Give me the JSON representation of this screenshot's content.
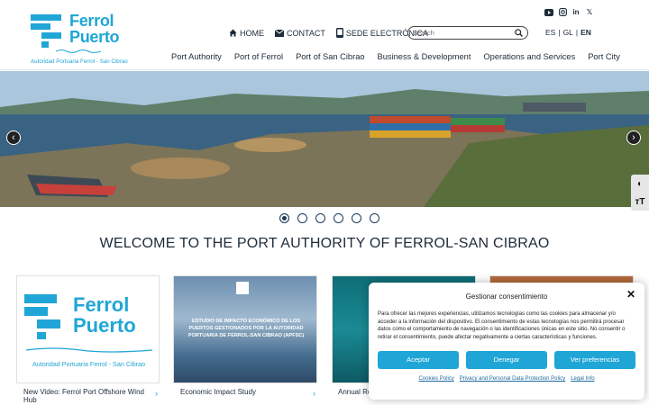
{
  "brand": {
    "name_line1": "Ferrol",
    "name_line2": "Puerto",
    "subtitle": "Autoridad Portuaria Ferrol - San Cibrao",
    "color": "#1fa6d6"
  },
  "toplinks": [
    {
      "label": "HOME",
      "icon": "home-icon"
    },
    {
      "label": "CONTACT",
      "icon": "mail-icon"
    },
    {
      "label": "SEDE ELECTRÓNICA",
      "icon": "phone-icon"
    }
  ],
  "search": {
    "placeholder": "Search"
  },
  "social": [
    "youtube-icon",
    "instagram-icon",
    "linkedin-icon",
    "x-icon"
  ],
  "lang": {
    "es": "ES",
    "gl": "GL",
    "en": "EN",
    "sep": "|",
    "active": "EN"
  },
  "nav": [
    "Port Authority",
    "Port of Ferrol",
    "Port of San Cibrao",
    "Business & Development",
    "Operations and Services",
    "Port City"
  ],
  "slider": {
    "count": 6,
    "active": 1
  },
  "welcome": "WELCOME TO THE PORT AUTHORITY OF FERROL-SAN CIBRAO",
  "cards": [
    {
      "caption": "New Video: Ferrol Port Offshore Wind Hub"
    },
    {
      "caption": "Economic Impact Study",
      "image_text": "ESTUDIO DE IMPACTO ECONÓMICO DE LOS PUERTOS GESTIONADOS POR LA AUTORIDAD PORTUARIA DE FERROL-SAN CIBRAO (APFSC)"
    },
    {
      "caption": "Annual Re"
    }
  ],
  "consent": {
    "title": "Gestionar consentimiento",
    "text": "Para ofrecer las mejores experiencias, utilizamos tecnologías como las cookies para almacenar y/o acceder a la información del dispositivo. El consentimiento de estas tecnologías nos permitirá procesar datos como el comportamiento de navegación o las identificaciones únicas en este sitio. No consentir o retirar el consentimiento, puede afectar negativamente a ciertas características y funciones.",
    "accept": "Aceptar",
    "deny": "Denegar",
    "prefs": "Ver preferencias",
    "links": [
      "Cookies Policy",
      "Privacy and Personal Data Protection Policy",
      "Legal Info"
    ]
  },
  "access": {
    "contrast": "◐",
    "text": "ᴛT"
  }
}
